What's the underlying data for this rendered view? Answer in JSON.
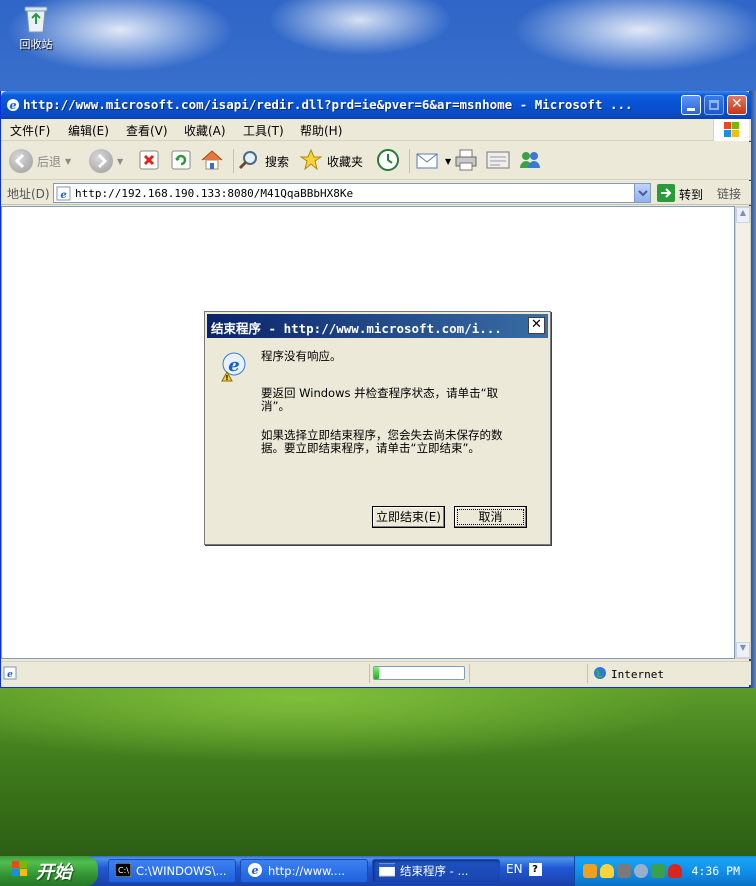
{
  "desktop": {
    "recycle_bin_label": "回收站"
  },
  "window": {
    "title": "http://www.microsoft.com/isapi/redir.dll?prd=ie&pver=6&ar=msnhome - Microsoft ...",
    "menu": [
      "文件(F)",
      "编辑(E)",
      "查看(V)",
      "收藏(A)",
      "工具(T)",
      "帮助(H)"
    ],
    "toolbar": {
      "back_label": "后退",
      "search_label": "搜索",
      "favorites_label": "收藏夹"
    },
    "address": {
      "label": "地址(D)",
      "url": "http://192.168.190.133:8080/M41QqaBBbHX8Ke",
      "go_label": "转到",
      "links_label": "链接"
    },
    "status": {
      "progress": 0.05,
      "zone_label": "Internet"
    }
  },
  "dialog": {
    "title": "结束程序 - http://www.microsoft.com/i...",
    "close_glyph": "✕",
    "line1": "程序没有响应。",
    "line2": "要返回 Windows 并检查程序状态，请单击“取消”。",
    "line3": "如果选择立即结束程序，您会失去尚未保存的数据。要立即结束程序，请单击“立即结束”。",
    "end_now_button": "立即结束(E)",
    "cancel_button": "取消"
  },
  "taskbar": {
    "start_label": "开始",
    "tasks": [
      {
        "label": "C:\\WINDOWS\\...",
        "icon": "cmd-icon"
      },
      {
        "label": "http://www....",
        "icon": "ie-icon"
      },
      {
        "label": "结束程序 - ...",
        "icon": "window-icon"
      }
    ],
    "language": "EN",
    "clock": "4:36 PM"
  },
  "colors": {
    "title_blue": "#0a5bdc",
    "dialog_title": "#0a246a",
    "start_green": "#3c9c3c",
    "tray_blue": "#0f8ae4"
  }
}
